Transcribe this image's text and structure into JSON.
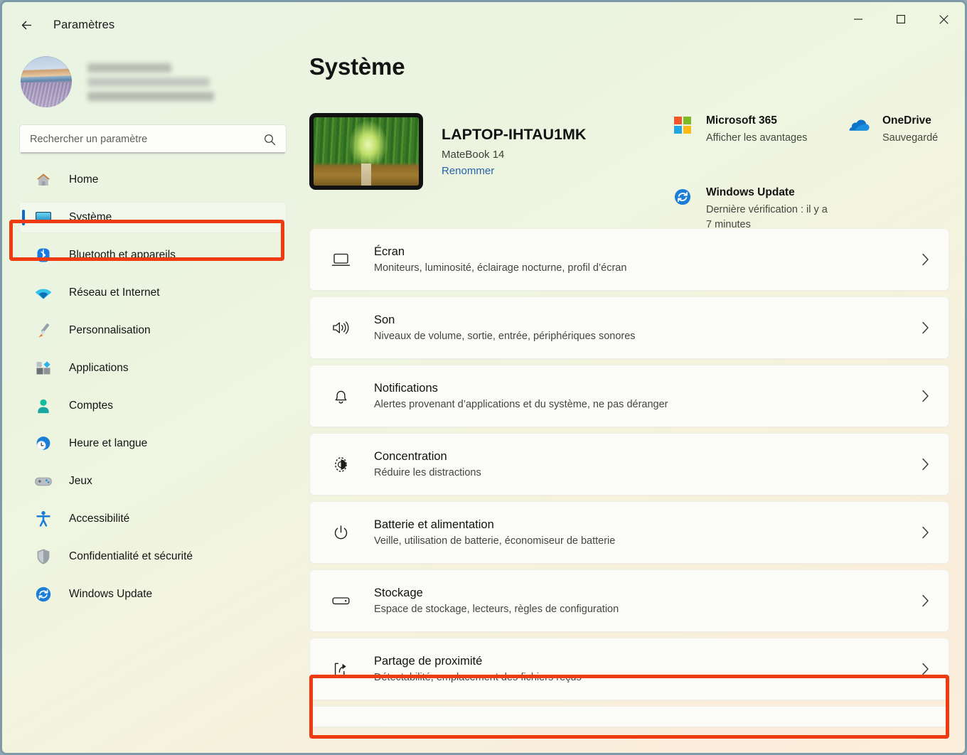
{
  "window": {
    "title": "Paramètres",
    "back_icon": "back-arrow-icon",
    "minimize_label": "Réduire",
    "maximize_label": "Agrandir",
    "close_label": "Fermer",
    "accent_red": "#ef3b11",
    "accent_blue": "#0b69c7",
    "bg_start": "#eaf4e2",
    "bg_end": "#fbeeda"
  },
  "sidebar": {
    "account": {
      "avatar_name": "user-avatar",
      "name_redacted": true
    },
    "search": {
      "placeholder": "Rechercher un paramètre",
      "value": "",
      "icon": "search-icon"
    },
    "items": [
      {
        "label": "Home",
        "icon": "home-icon",
        "active": false
      },
      {
        "label": "Système",
        "icon": "monitor-icon",
        "active": true
      },
      {
        "label": "Bluetooth et appareils",
        "icon": "bluetooth-icon",
        "active": false
      },
      {
        "label": "Réseau et Internet",
        "icon": "wifi-icon",
        "active": false
      },
      {
        "label": "Personnalisation",
        "icon": "paintbrush-icon",
        "active": false
      },
      {
        "label": "Applications",
        "icon": "apps-icon",
        "active": false
      },
      {
        "label": "Comptes",
        "icon": "person-icon",
        "active": false
      },
      {
        "label": "Heure et langue",
        "icon": "clock-globe-icon",
        "active": false
      },
      {
        "label": "Jeux",
        "icon": "gamepad-icon",
        "active": false
      },
      {
        "label": "Accessibilité",
        "icon": "accessibility-icon",
        "active": false
      },
      {
        "label": "Confidentialité et sécurité",
        "icon": "shield-icon",
        "active": false
      },
      {
        "label": "Windows Update",
        "icon": "update-icon",
        "active": false
      }
    ]
  },
  "main": {
    "page_title": "Système",
    "device": {
      "name": "LAPTOP-IHTAU1MK",
      "model": "MateBook 14",
      "rename_link": "Renommer",
      "thumbnail_name": "device-wallpaper-thumbnail"
    },
    "info_cards": [
      {
        "id": "m365",
        "title": "Microsoft 365",
        "subtitle": "Afficher les avantages",
        "icon": "microsoft-logo-icon"
      },
      {
        "id": "onedrive",
        "title": "OneDrive",
        "subtitle": "Sauvegardé",
        "icon": "onedrive-cloud-icon"
      },
      {
        "id": "windows-update",
        "title": "Windows Update",
        "subtitle": "Dernière vérification : il y a 7 minutes",
        "icon": "update-icon"
      }
    ],
    "rows": [
      {
        "title": "Écran",
        "subtitle": "Moniteurs, luminosité, éclairage nocturne, profil d’écran",
        "icon": "display-icon",
        "highlighted": false
      },
      {
        "title": "Son",
        "subtitle": "Niveaux de volume, sortie, entrée, périphériques sonores",
        "icon": "speaker-icon",
        "highlighted": false
      },
      {
        "title": "Notifications",
        "subtitle": "Alertes provenant d’applications et du système, ne pas déranger",
        "icon": "bell-icon",
        "highlighted": false
      },
      {
        "title": "Concentration",
        "subtitle": "Réduire les distractions",
        "icon": "focus-icon",
        "highlighted": false
      },
      {
        "title": "Batterie et alimentation",
        "subtitle": "Veille, utilisation de batterie, économiseur de batterie",
        "icon": "power-icon",
        "highlighted": false
      },
      {
        "title": "Stockage",
        "subtitle": "Espace de stockage, lecteurs, règles de configuration",
        "icon": "drive-icon",
        "highlighted": false
      },
      {
        "title": "Partage de proximité",
        "subtitle": "Détectabilité, emplacement des fichiers reçus",
        "icon": "share-icon",
        "highlighted": true
      }
    ],
    "chevron_icon": "chevron-right-icon"
  }
}
